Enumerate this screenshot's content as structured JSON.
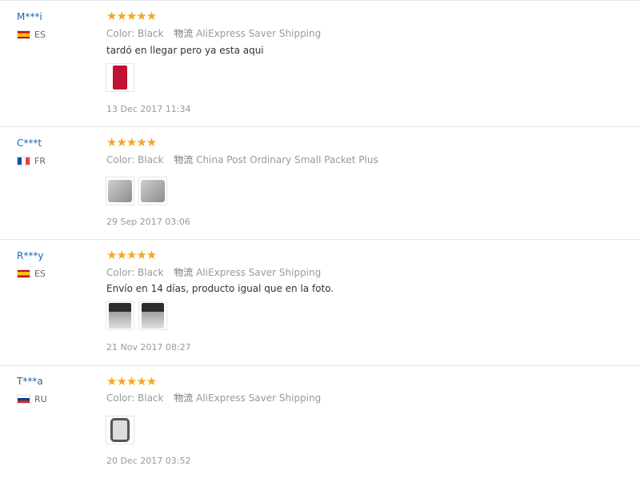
{
  "reviews": [
    {
      "user": "M***i",
      "country": "ES",
      "flag": "es",
      "stars": "★★★★★",
      "color_label": "Color:",
      "color_value": "Black",
      "shipping_label": "物流",
      "shipping_value": "AliExpress Saver Shipping",
      "comment": "tardó en llegar pero ya esta aqui",
      "photos": [
        "red-phone-case-photo"
      ],
      "date": "13 Dec 2017 11:34"
    },
    {
      "user": "C***t",
      "country": "FR",
      "flag": "fr",
      "stars": "★★★★★",
      "color_label": "Color:",
      "color_value": "Black",
      "shipping_label": "物流",
      "shipping_value": "China Post Ordinary Small Packet Plus",
      "comment": "",
      "photos": [
        "gray-case-photo",
        "gray-case-photo"
      ],
      "date": "29 Sep 2017 03:06"
    },
    {
      "user": "R***y",
      "country": "ES",
      "flag": "es",
      "stars": "★★★★★",
      "color_label": "Color:",
      "color_value": "Black",
      "shipping_label": "物流",
      "shipping_value": "AliExpress Saver Shipping",
      "comment": "Envío en 14 días, producto igual que en la foto.",
      "photos": [
        "dark-case-photo",
        "dark-case-photo"
      ],
      "date": "21 Nov 2017 08:27"
    },
    {
      "user": "T***a",
      "country": "RU",
      "flag": "ru",
      "stars": "★★★★★",
      "color_label": "Color:",
      "color_value": "Black",
      "shipping_label": "物流",
      "shipping_value": "AliExpress Saver Shipping",
      "comment": "",
      "photos": [
        "frame-case-photo"
      ],
      "date": "20 Dec 2017 03:52"
    }
  ],
  "colors": {
    "star": "#f5a623",
    "username": "#1c64b3",
    "separator": "#e6e6e6"
  }
}
